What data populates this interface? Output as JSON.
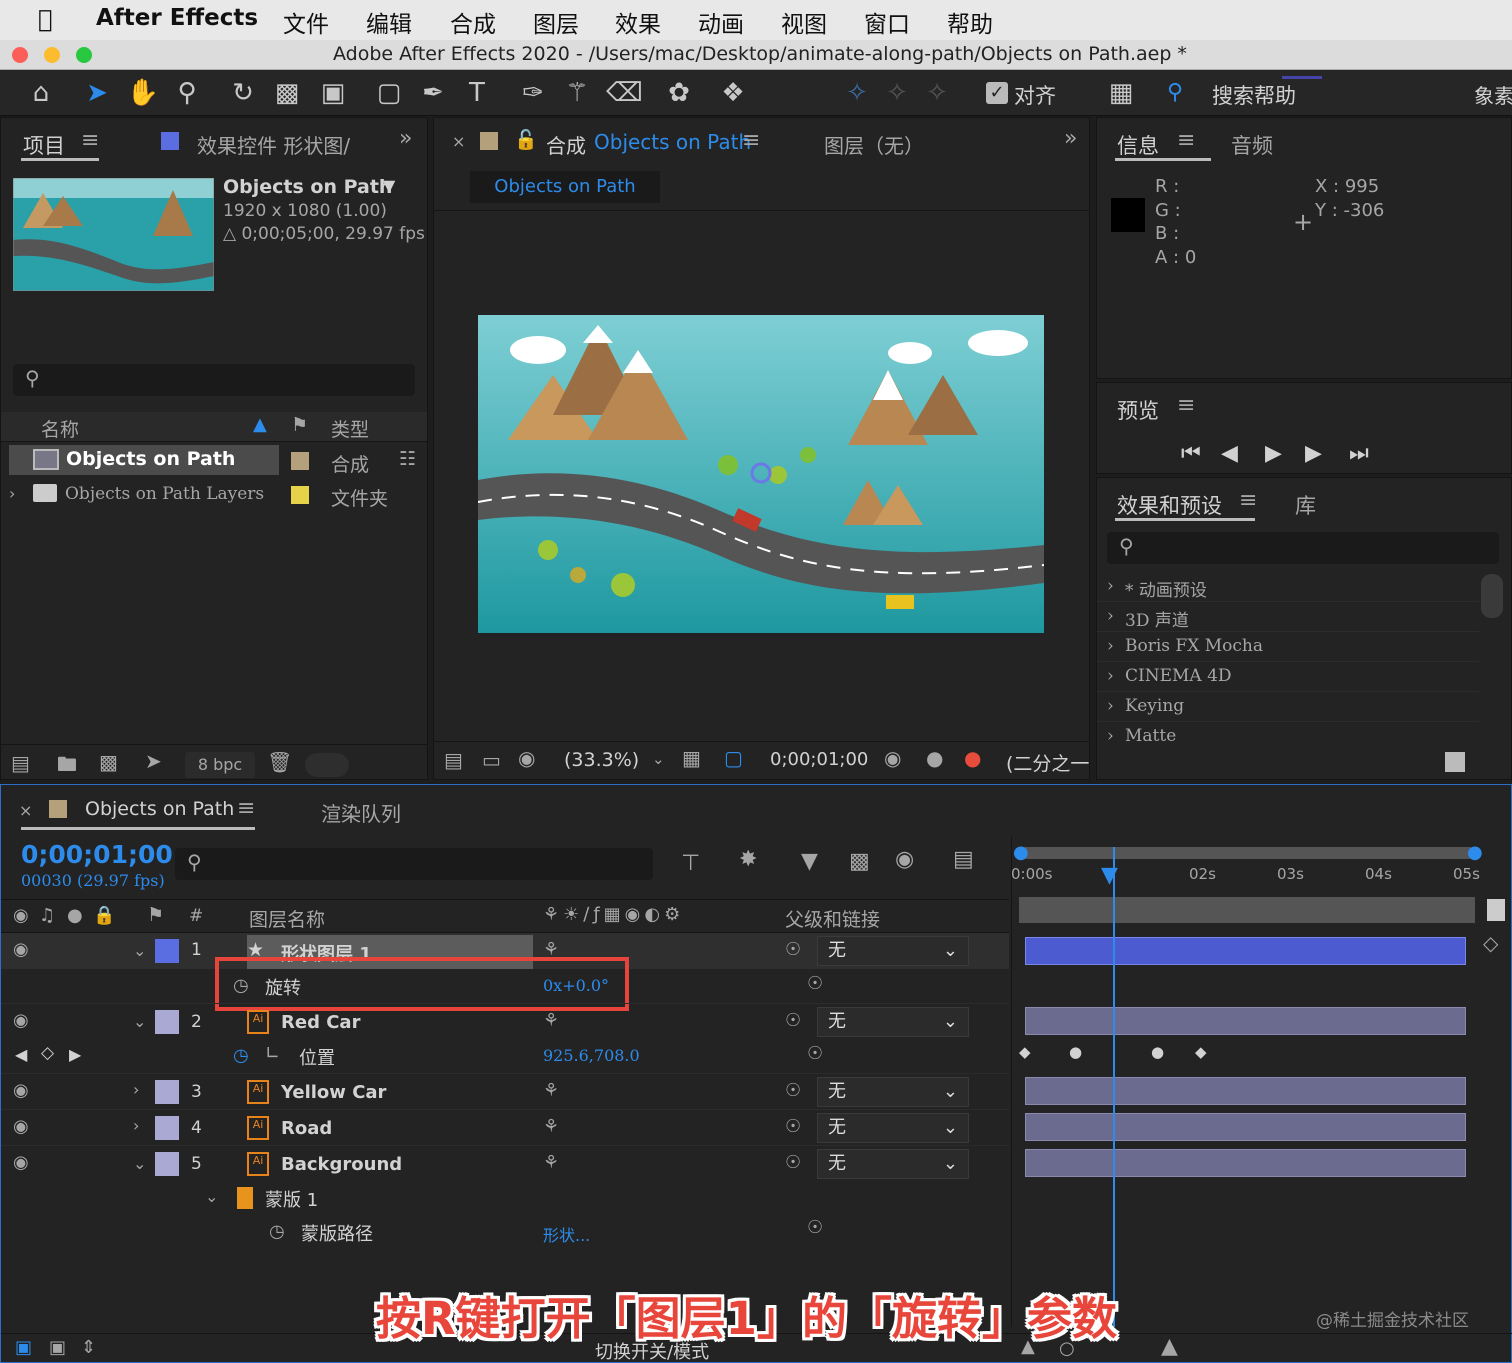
{
  "menubar": {
    "app": "After Effects",
    "items": [
      "文件",
      "编辑",
      "合成",
      "图层",
      "效果",
      "动画",
      "视图",
      "窗口",
      "帮助"
    ]
  },
  "window": {
    "title": "Adobe After Effects 2020 - /Users/mac/Desktop/animate-along-path/Objects on Path.aep *"
  },
  "toolbar": {
    "align_label": "对齐",
    "search_help": "搜索帮助",
    "right_cut": "象素"
  },
  "project": {
    "tab_label": "项目",
    "effects_tab": "效果控件 形状图/",
    "comp_name": "Objects on Path",
    "comp_res": "1920 x 1080 (1.00)",
    "comp_dur": "△ 0;00;05;00, 29.97 fps",
    "col_name": "名称",
    "col_type": "类型",
    "items": [
      {
        "name": "Objects on Path",
        "type": "合成",
        "color": "#b4a17c"
      },
      {
        "name": "Objects on Path Layers",
        "type": "文件夹",
        "color": "#e7d34a"
      }
    ],
    "bpc": "8 bpc"
  },
  "composition": {
    "tab_prefix": "合成",
    "tab_name": "Objects on Path",
    "layer_tab": "图层（无）",
    "breadcrumb": "Objects on Path",
    "zoom": "(33.3%)",
    "time": "0;00;01;00",
    "resolution": "(二分之一"
  },
  "info": {
    "tab": "信息",
    "audio_tab": "音频",
    "r": "R :",
    "g": "G :",
    "b": "B :",
    "a": "A :  0",
    "x": "X : 995",
    "y": "Y :  -306"
  },
  "preview": {
    "tab": "预览"
  },
  "effects": {
    "tab": "效果和预设",
    "lib_tab": "库",
    "items": [
      "* 动画预设",
      "3D 声道",
      "Boris FX Mocha",
      "CINEMA 4D",
      "Keying",
      "Matte"
    ]
  },
  "timeline": {
    "tab": "Objects on Path",
    "render_tab": "渲染队列",
    "timecode": "0;00;01;00",
    "frames": "00030 (29.97 fps)",
    "col_layer_name": "图层名称",
    "col_num": "#",
    "col_parent": "父级和链接",
    "ruler": [
      "0:00s",
      "02s",
      "03s",
      "04s",
      "05s"
    ],
    "layers": [
      {
        "num": "1",
        "name": "形状图层 1",
        "parent": "无",
        "color": "#5b6ee1"
      },
      {
        "num": "2",
        "name": "Red Car",
        "parent": "无",
        "color": "#a9a9d3"
      },
      {
        "num": "3",
        "name": "Yellow Car",
        "parent": "无",
        "color": "#a9a9d3"
      },
      {
        "num": "4",
        "name": "Road",
        "parent": "无",
        "color": "#a9a9d3"
      },
      {
        "num": "5",
        "name": "Background",
        "parent": "无",
        "color": "#a9a9d3"
      }
    ],
    "rotation": {
      "label": "旋转",
      "value": "0x+0.0°"
    },
    "position": {
      "label": "位置",
      "value": "925.6,708.0"
    },
    "mask": {
      "label": "蒙版 1",
      "path_label": "蒙版路径",
      "path_value": "形状..."
    },
    "footer": "切换开关/模式"
  },
  "overlay": {
    "caption": "按R键打开「图层1」的「旋转」参数",
    "watermark": "@稀土掘金技术社区"
  },
  "colors": {
    "accent": "#2d8ceb",
    "highlight": "#e7453b",
    "layer1": "#5b6ee1"
  }
}
